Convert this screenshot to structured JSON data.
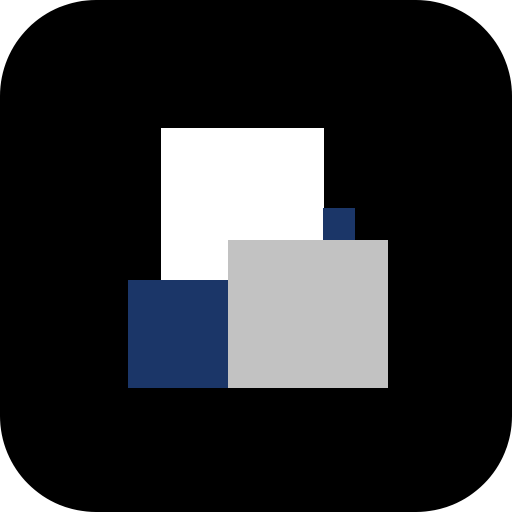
{
  "icon": {
    "name": "app-icon",
    "background_color": "#000000",
    "shapes": [
      {
        "name": "white-square",
        "color": "#ffffff"
      },
      {
        "name": "small-navy-square",
        "color": "#1b3668"
      },
      {
        "name": "navy-square",
        "color": "#1b3668"
      },
      {
        "name": "grey-square",
        "color": "#c2c2c2"
      }
    ]
  }
}
